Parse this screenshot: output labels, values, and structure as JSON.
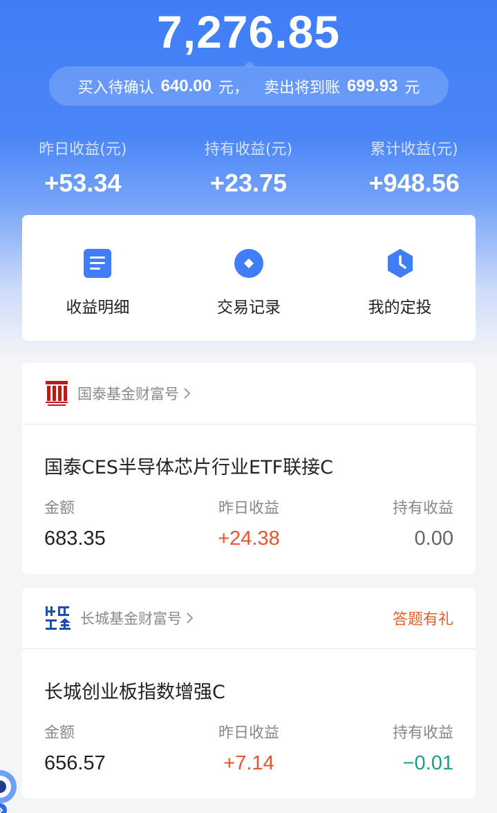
{
  "summary": {
    "total": "7,276.85",
    "buy_label": "买入待确认",
    "buy_amount": "640.00",
    "buy_unit": "元，",
    "sell_label": "卖出将到账",
    "sell_amount": "699.93",
    "sell_unit": "元"
  },
  "stats": [
    {
      "label": "昨日收益(元)",
      "value": "+53.34"
    },
    {
      "label": "持有收益(元)",
      "value": "+23.75"
    },
    {
      "label": "累计收益(元)",
      "value": "+948.56"
    }
  ],
  "quick_actions": [
    {
      "label": "收益明细",
      "icon": "document-icon"
    },
    {
      "label": "交易记录",
      "icon": "record-icon"
    },
    {
      "label": "我的定投",
      "icon": "clock-icon"
    }
  ],
  "colors": {
    "primary": "#3f7ef7",
    "positive": "#e5542c",
    "negative": "#1aa08a",
    "promo": "#e5602d"
  },
  "cards": [
    {
      "brand": "国泰基金财富号",
      "logo": "guotai-logo",
      "promo": "",
      "fund_name": "国泰CES半导体芯片行业ETF联接C",
      "amount_label": "金额",
      "amount": "683.35",
      "yday_label": "昨日收益",
      "yday": "+24.38",
      "hold_label": "持有收益",
      "hold": "0.00"
    },
    {
      "brand": "长城基金财富号",
      "logo": "changcheng-logo",
      "promo": "答题有礼",
      "fund_name": "长城创业板指数增强C",
      "amount_label": "金额",
      "amount": "656.57",
      "yday_label": "昨日收益",
      "yday": "+7.14",
      "hold_label": "持有收益",
      "hold": "−0.01"
    }
  ]
}
